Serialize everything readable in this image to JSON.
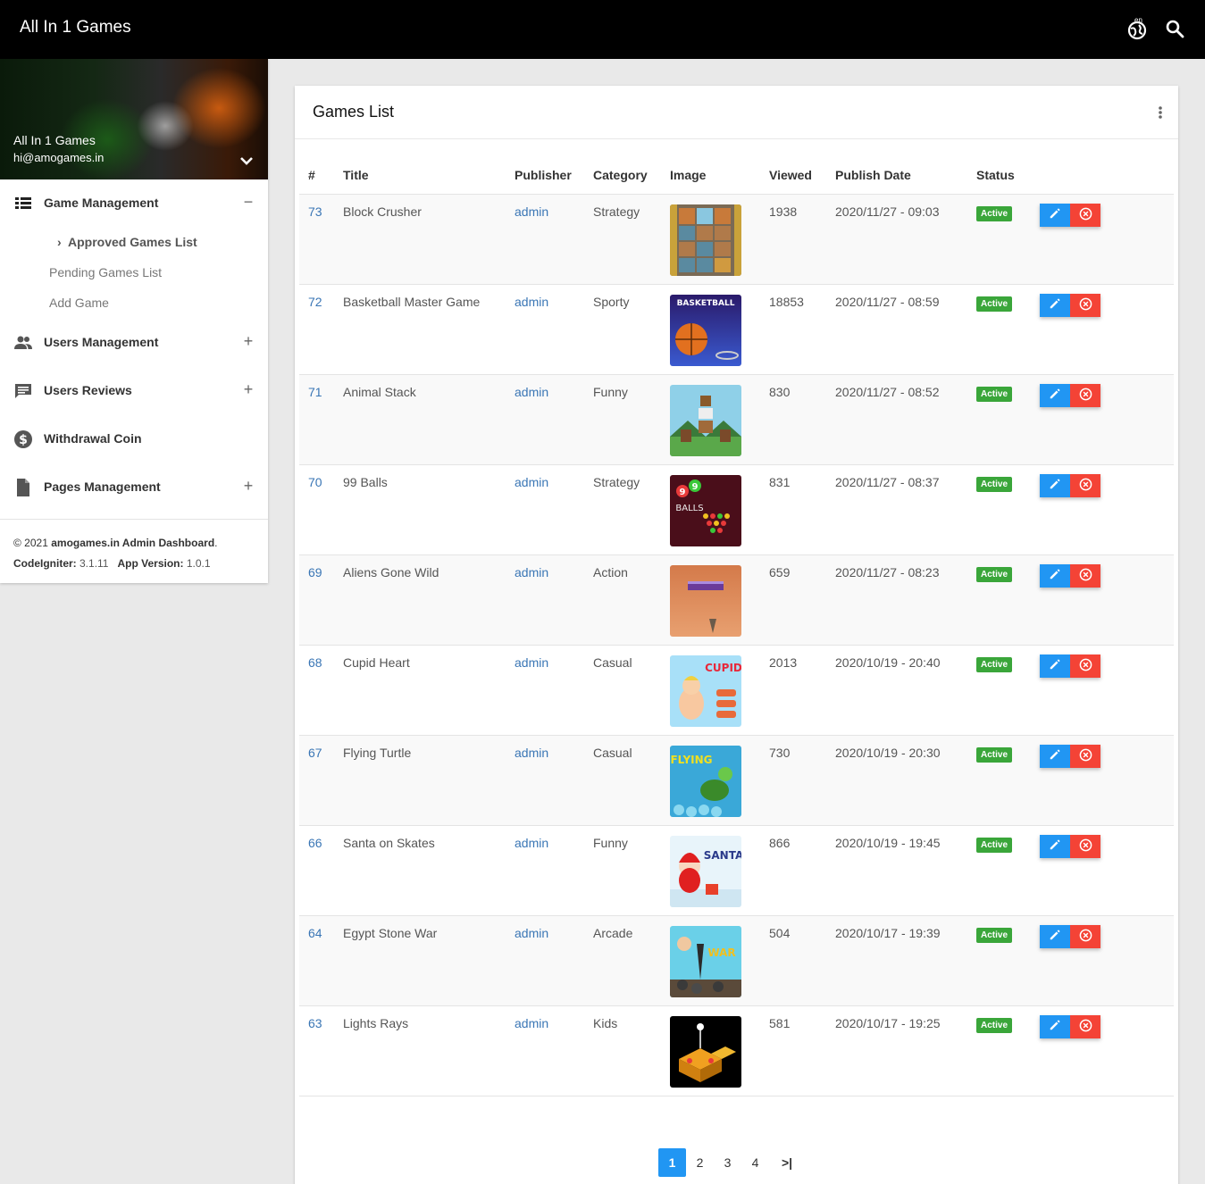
{
  "header": {
    "brand": "All In 1 Games",
    "lang_code": "en"
  },
  "user": {
    "name": "All In 1 Games",
    "email": "hi@amogames.in"
  },
  "menu": {
    "game_management": {
      "label": "Game Management",
      "toggle": "−"
    },
    "approved": "Approved Games List",
    "pending": "Pending Games List",
    "add_game": "Add Game",
    "users_management": {
      "label": "Users Management",
      "toggle": "+"
    },
    "users_reviews": {
      "label": "Users Reviews",
      "toggle": "+"
    },
    "withdrawal": {
      "label": "Withdrawal Coin"
    },
    "pages_management": {
      "label": "Pages Management",
      "toggle": "+"
    }
  },
  "footer": {
    "copy": "© 2021 ",
    "site": "amogames.in Admin Dashboard",
    "dot": ".",
    "ci_label": "CodeIgniter:",
    "ci_version": " 3.1.11",
    "app_label": "App Version:",
    "app_version": " 1.0.1"
  },
  "card": {
    "title": "Games List"
  },
  "columns": [
    "#",
    "Title",
    "Publisher",
    "Category",
    "Image",
    "Viewed",
    "Publish Date",
    "Status"
  ],
  "games": [
    {
      "id": "73",
      "title": "Block Crusher",
      "publisher": "admin",
      "category": "Strategy",
      "viewed": "1938",
      "date": "2020/11/27 - 09:03",
      "status": "Active",
      "image": "block-crusher"
    },
    {
      "id": "72",
      "title": "Basketball Master Game",
      "publisher": "admin",
      "category": "Sporty",
      "viewed": "18853",
      "date": "2020/11/27 - 08:59",
      "status": "Active",
      "image": "basketball-master",
      "image_text": "BASKETBALL"
    },
    {
      "id": "71",
      "title": "Animal Stack",
      "publisher": "admin",
      "category": "Funny",
      "viewed": "830",
      "date": "2020/11/27 - 08:52",
      "status": "Active",
      "image": "animal-stack"
    },
    {
      "id": "70",
      "title": "99 Balls",
      "publisher": "admin",
      "category": "Strategy",
      "viewed": "831",
      "date": "2020/11/27 - 08:37",
      "status": "Active",
      "image": "99-balls",
      "image_text": "BALLS"
    },
    {
      "id": "69",
      "title": "Aliens Gone Wild",
      "publisher": "admin",
      "category": "Action",
      "viewed": "659",
      "date": "2020/11/27 - 08:23",
      "status": "Active",
      "image": "aliens-gone-wild"
    },
    {
      "id": "68",
      "title": "Cupid Heart",
      "publisher": "admin",
      "category": "Casual",
      "viewed": "2013",
      "date": "2020/10/19 - 20:40",
      "status": "Active",
      "image": "cupid-heart",
      "image_text": "CUPID"
    },
    {
      "id": "67",
      "title": "Flying Turtle",
      "publisher": "admin",
      "category": "Casual",
      "viewed": "730",
      "date": "2020/10/19 - 20:30",
      "status": "Active",
      "image": "flying-turtle",
      "image_text": "FLYING"
    },
    {
      "id": "66",
      "title": "Santa on Skates",
      "publisher": "admin",
      "category": "Funny",
      "viewed": "866",
      "date": "2020/10/19 - 19:45",
      "status": "Active",
      "image": "santa-on-skates",
      "image_text": "SANTA"
    },
    {
      "id": "64",
      "title": "Egypt Stone War",
      "publisher": "admin",
      "category": "Arcade",
      "viewed": "504",
      "date": "2020/10/17 - 19:39",
      "status": "Active",
      "image": "egypt-stone-war",
      "image_text": "WAR"
    },
    {
      "id": "63",
      "title": "Lights Rays",
      "publisher": "admin",
      "category": "Kids",
      "viewed": "581",
      "date": "2020/10/17 - 19:25",
      "status": "Active",
      "image": "lights-rays"
    }
  ],
  "pagination": {
    "pages": [
      "1",
      "2",
      "3",
      "4"
    ],
    "current": "1",
    "last": ">|"
  },
  "icons": {
    "lang": "language-globe-icon",
    "search": "search-icon",
    "more": "more-vertical-icon",
    "edit": "pencil-icon",
    "delete": "close-circle-icon"
  },
  "colors": {
    "link": "#3a76b5",
    "active_badge": "#3aa63a",
    "edit": "#2196f3",
    "delete": "#f44336"
  }
}
